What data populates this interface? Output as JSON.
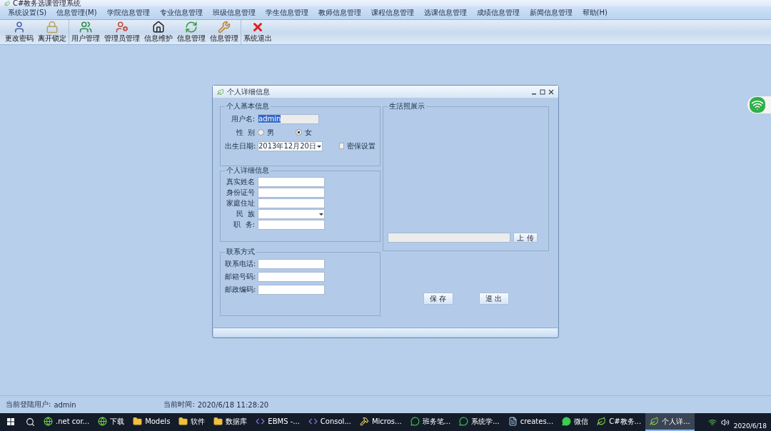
{
  "app_title": "C#教务选课管理系统",
  "menu": [
    "系统设置(S)",
    "信息管理(M)",
    "学院信息管理",
    "专业信息管理",
    "班级信息管理",
    "学生信息管理",
    "教师信息管理",
    "课程信息管理",
    "选课信息管理",
    "成绩信息管理",
    "新闻信息管理",
    "帮助(H)"
  ],
  "toolbar": [
    {
      "label": "更改密码",
      "kind": "user"
    },
    {
      "label": "离开锁定",
      "kind": "lock"
    },
    {
      "label": "用户管理",
      "kind": "users"
    },
    {
      "label": "管理员管理",
      "kind": "admins"
    },
    {
      "label": "信息维护",
      "kind": "home"
    },
    {
      "label": "信息管理",
      "kind": "refresh"
    },
    {
      "label": "信息管理",
      "kind": "tools"
    },
    {
      "label": "系统退出",
      "kind": "exit"
    }
  ],
  "dialog": {
    "title": "个人详细信息",
    "basic": {
      "title": "个人基本信息",
      "username_label": "用户名:",
      "username": "admin",
      "gender_label": "性  别",
      "genders": [
        {
          "label": "男",
          "selected": false
        },
        {
          "label": "女",
          "selected": true
        }
      ],
      "birth_label": "出生日期:",
      "birth": "2013年12月20日",
      "security": {
        "label": "密保设置",
        "checked": false
      }
    },
    "detail": {
      "title": "个人详细信息",
      "fields": [
        {
          "label": "真实姓名",
          "kind": "text"
        },
        {
          "label": "身份证号",
          "kind": "text"
        },
        {
          "label": "家庭住址",
          "kind": "text"
        },
        {
          "label": "民  族",
          "kind": "select"
        },
        {
          "label": "职  务:",
          "kind": "text"
        }
      ]
    },
    "contact": {
      "title": "联系方式",
      "fields": [
        {
          "label": "联系电话:"
        },
        {
          "label": "邮箱号码:"
        },
        {
          "label": "邮政编码:"
        }
      ]
    },
    "photo": {
      "title": "生活照展示",
      "upload": "上 传"
    },
    "buttons": [
      "保 存",
      "退 出"
    ]
  },
  "status": {
    "user_label": "当前登陆用户:",
    "user": "admin",
    "time_label": "当前时间:",
    "time": "2020/6/18 11:28:20"
  },
  "taskbar": [
    {
      "label": ".net cor...",
      "kind": "browser",
      "active": false
    },
    {
      "label": "下载",
      "kind": "browser",
      "active": false
    },
    {
      "label": "Models",
      "kind": "folder",
      "active": false
    },
    {
      "label": "软件",
      "kind": "folder",
      "active": false
    },
    {
      "label": "数据库",
      "kind": "folder",
      "active": false
    },
    {
      "label": "EBMS -...",
      "kind": "studio",
      "active": false
    },
    {
      "label": "Consol...",
      "kind": "studio",
      "active": false
    },
    {
      "label": "Micros...",
      "kind": "tool",
      "active": false
    },
    {
      "label": "班务笔...",
      "kind": "chat",
      "active": false
    },
    {
      "label": "系统学...",
      "kind": "chat",
      "active": false
    },
    {
      "label": "creates...",
      "kind": "file",
      "active": false
    },
    {
      "label": "微信",
      "kind": "wechat",
      "active": false
    },
    {
      "label": "C#教务...",
      "kind": "leaf",
      "active": false
    },
    {
      "label": "个人详...",
      "kind": "leaf",
      "active": true
    }
  ],
  "clock_date": "2020/6/18"
}
